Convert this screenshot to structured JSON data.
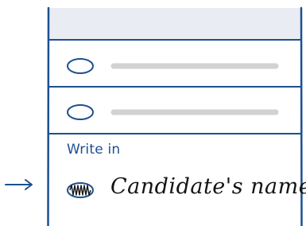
{
  "write_in": {
    "label": "Write in",
    "candidate_name": "Candidate's name",
    "oval_state": "filled"
  },
  "options": [
    {
      "oval_state": "empty",
      "name_state": "placeholder-line"
    },
    {
      "oval_state": "empty",
      "name_state": "placeholder-line"
    }
  ],
  "icons": {
    "pointer": "arrow-right-icon",
    "write_in_oval": "filled-oval-icon"
  },
  "colors": {
    "border": "#1d4f91",
    "header_band": "#e9ecf2",
    "placeholder_line": "#d2d2d2",
    "label_text": "#1d4f91",
    "handwriting": "#141414"
  }
}
